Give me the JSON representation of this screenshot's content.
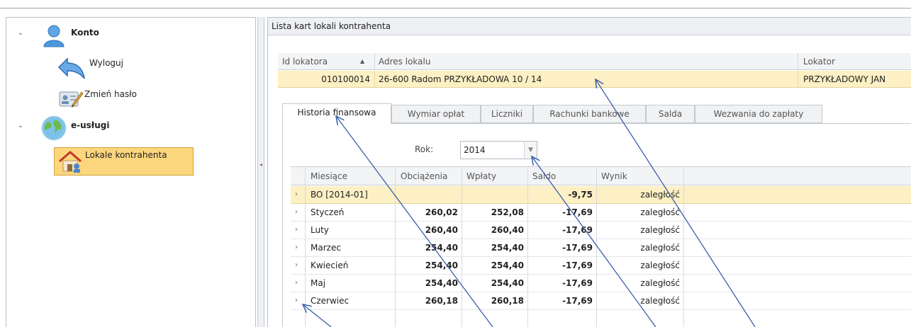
{
  "sidebar": {
    "konto": {
      "label": "Konto"
    },
    "wyloguj": {
      "label": "Wyloguj"
    },
    "zmien_haslo": {
      "label": "Zmień hasło"
    },
    "e_uslugi": {
      "label": "e-usługi"
    },
    "lokale": {
      "label": "Lokale kontrahenta"
    }
  },
  "main": {
    "panel_title": "Lista kart lokali kontrahenta",
    "locals_grid": {
      "columns": [
        "Id lokatora",
        "Adres lokalu",
        "Lokator"
      ],
      "sort_indicator": "▲",
      "rows": [
        {
          "id": "010100014",
          "address": "26-600 Radom PRZYKŁADOWA 10 / 14",
          "tenant": "PRZYKŁADOWY JAN"
        }
      ]
    },
    "tabs": [
      "Historia finansowa",
      "Wymiar opłat",
      "Liczniki",
      "Rachunki bankowe",
      "Salda",
      "Wezwania do zapłaty"
    ],
    "active_tab": "Historia finansowa",
    "year": {
      "label": "Rok:",
      "value": "2014"
    },
    "finance_grid": {
      "columns": [
        "Miesiące",
        "Obciążenia",
        "Wpłaty",
        "Saldo",
        "Wynik"
      ],
      "rows": [
        {
          "month": "BO [2014-01]",
          "charges": "",
          "payments": "",
          "balance": "-9,75",
          "result": "zaległość"
        },
        {
          "month": "Styczeń",
          "charges": "260,02",
          "payments": "252,08",
          "balance": "-17,69",
          "result": "zaległość"
        },
        {
          "month": "Luty",
          "charges": "260,40",
          "payments": "260,40",
          "balance": "-17,69",
          "result": "zaległość"
        },
        {
          "month": "Marzec",
          "charges": "254,40",
          "payments": "254,40",
          "balance": "-17,69",
          "result": "zaległość"
        },
        {
          "month": "Kwiecień",
          "charges": "254,40",
          "payments": "254,40",
          "balance": "-17,69",
          "result": "zaległość"
        },
        {
          "month": "Maj",
          "charges": "254,40",
          "payments": "254,40",
          "balance": "-17,69",
          "result": "zaległość"
        },
        {
          "month": "Czerwiec",
          "charges": "260,18",
          "payments": "260,18",
          "balance": "-17,69",
          "result": "zaległość"
        }
      ]
    }
  },
  "colors": {
    "selection": "#fcd67c",
    "row_highlight": "#fcf0c4",
    "annotation_arrow": "#3a5fa8"
  }
}
